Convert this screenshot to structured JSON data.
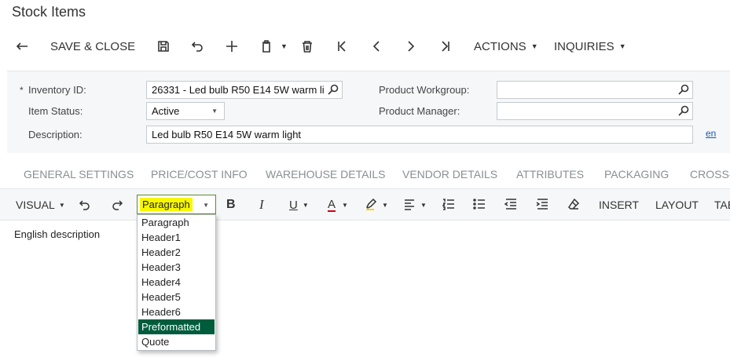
{
  "page_title": "Stock Items",
  "toolbar": {
    "save_close": "SAVE & CLOSE",
    "actions": "ACTIONS",
    "inquiries": "INQUIRIES"
  },
  "form": {
    "required_marker": "*",
    "inventory_id_label": "Inventory ID:",
    "inventory_id_value": "26331 - Led bulb R50 E14 5W warm li",
    "item_status_label": "Item Status:",
    "item_status_value": "Active",
    "description_label": "Description:",
    "description_value": "Led bulb R50 E14 5W warm light",
    "product_workgroup_label": "Product Workgroup:",
    "product_workgroup_value": "",
    "product_manager_label": "Product Manager:",
    "product_manager_value": "",
    "language_link": "en"
  },
  "tabs": [
    "GENERAL SETTINGS",
    "PRICE/COST INFO",
    "WAREHOUSE DETAILS",
    "VENDOR DETAILS",
    "ATTRIBUTES",
    "PACKAGING",
    "CROSS-"
  ],
  "editor": {
    "visual": "VISUAL",
    "style_selected": "Paragraph",
    "bold": "B",
    "italic": "I",
    "underline": "U",
    "font_color": "A",
    "insert": "INSERT",
    "layout": "LAYOUT",
    "table": "TAE",
    "content": "English description",
    "style_options": [
      "Paragraph",
      "Header1",
      "Header2",
      "Header3",
      "Header4",
      "Header5",
      "Header6",
      "Preformatted",
      "Quote"
    ],
    "highlighted_option": "Preformatted"
  },
  "colors": {
    "highlight_yellow": "#f7f700",
    "selected_option_bg": "#005c3c",
    "font_color_red": "#d0021b",
    "highlighter_yellow": "#f2d40c",
    "link_blue": "#1a57b4"
  }
}
